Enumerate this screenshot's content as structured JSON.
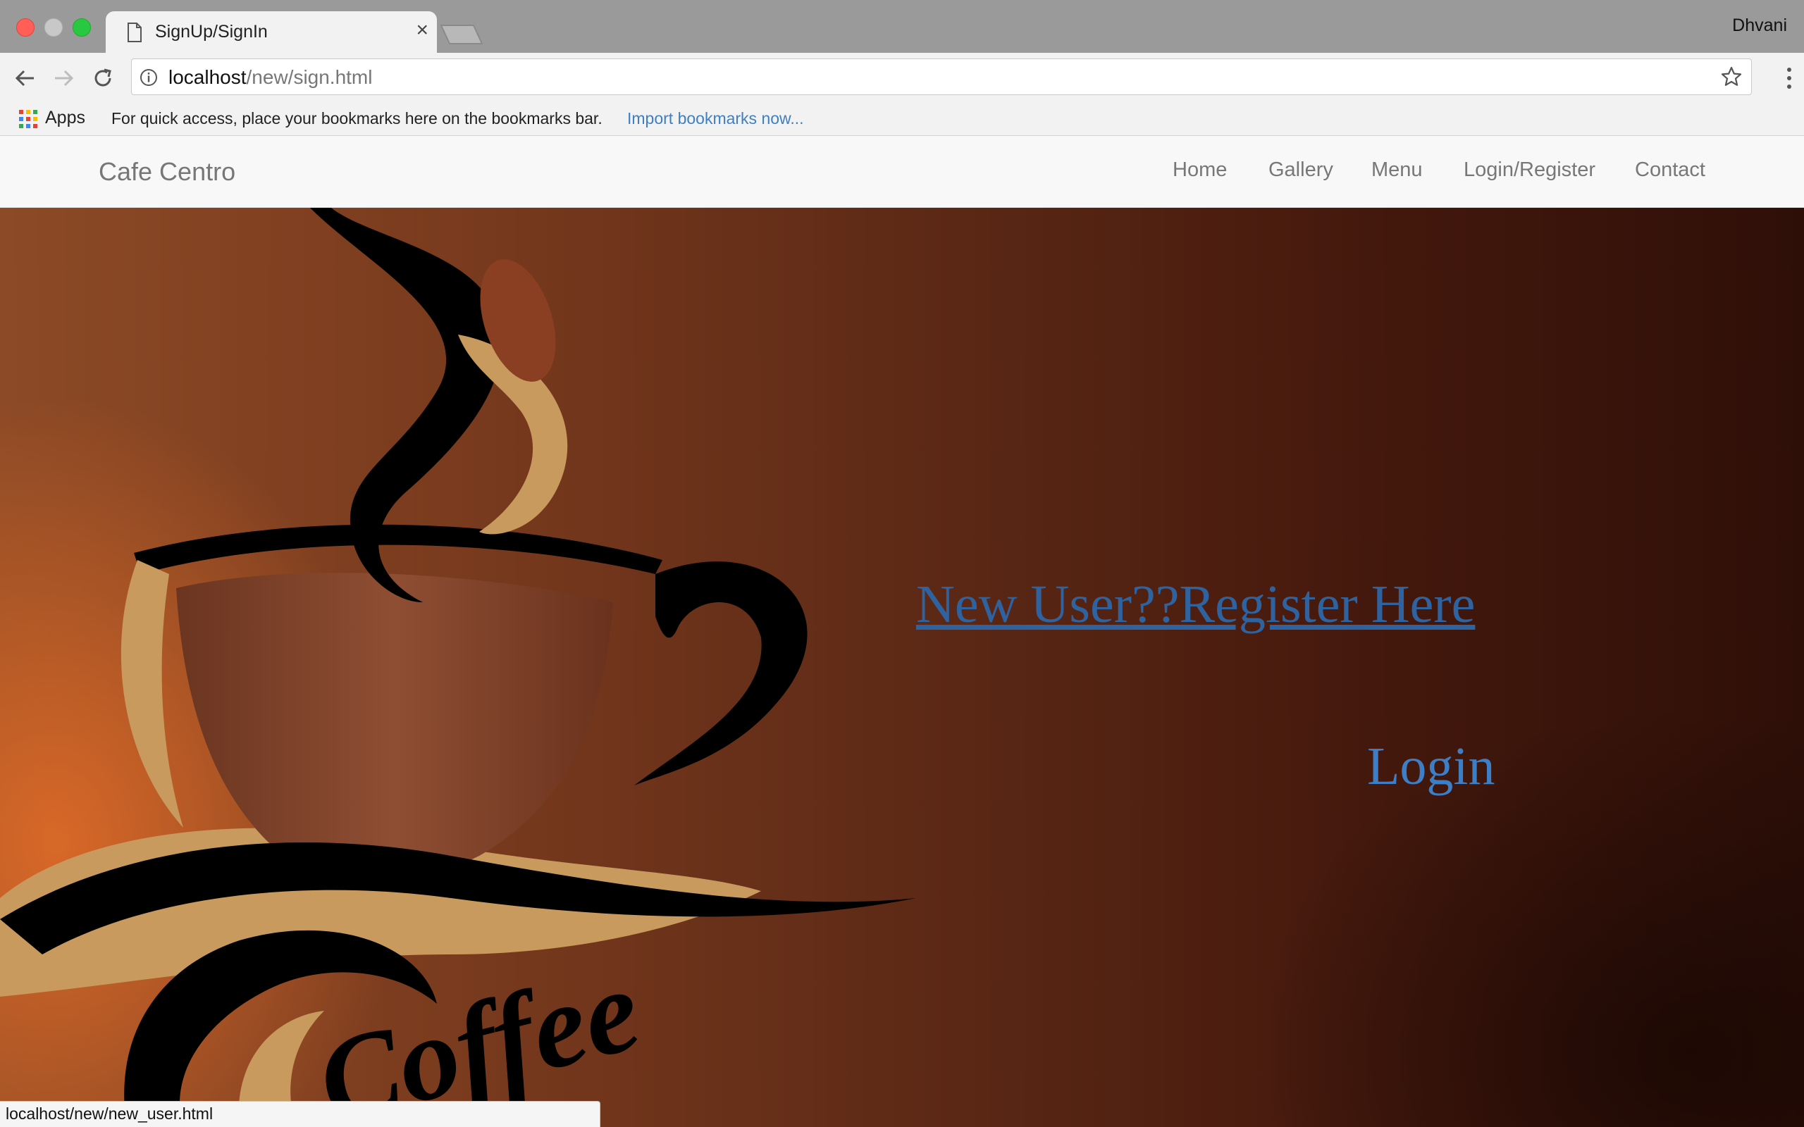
{
  "browser": {
    "tab_title": "SignUp/SignIn",
    "tab_close": "×",
    "profile_name": "Dhvani",
    "url_host": "localhost",
    "url_path": "/new/sign.html",
    "bookmarks": {
      "apps_label": "Apps",
      "hint": "For quick access, place your bookmarks here on the bookmarks bar.",
      "import_link": "Import bookmarks now..."
    },
    "status_url": "localhost/new/new_user.html"
  },
  "navbar": {
    "brand": "Cafe Centro",
    "links": [
      {
        "label": "Home"
      },
      {
        "label": "Gallery"
      },
      {
        "label": "Menu"
      },
      {
        "label": "Login/Register"
      },
      {
        "label": "Contact"
      }
    ]
  },
  "hero": {
    "register_text": "New User??Register Here",
    "login_text": "Login",
    "art_text": "Coffee"
  },
  "colors": {
    "link_visited": "#2e63a0",
    "link": "#3d7fc6",
    "brown_dark": "#2e0f08",
    "tan": "#c99a5e"
  }
}
